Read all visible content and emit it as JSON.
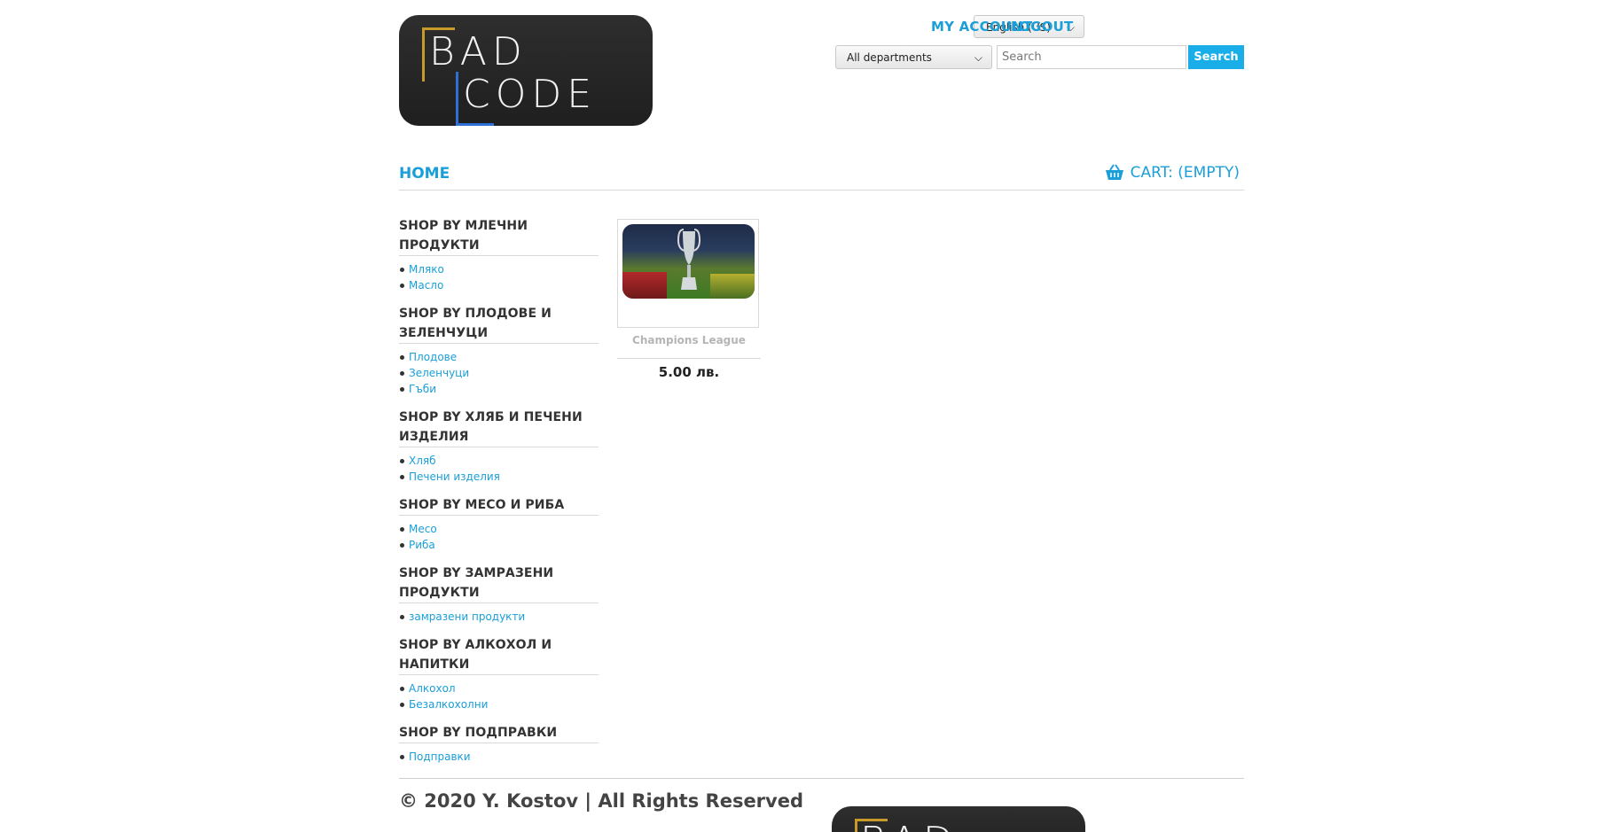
{
  "logo": {
    "line1": "BAD",
    "line2": "CODE"
  },
  "header": {
    "language": "English (US)",
    "my_account": "MY ACCOUNT",
    "logout": "LOGOUT",
    "department": "All departments",
    "search_placeholder": "Search",
    "search_button": "Search"
  },
  "nav": {
    "home": "HOME",
    "cart": "CART: (EMPTY)"
  },
  "sidebar": {
    "categories": [
      {
        "title": "SHOP BY МЛЕЧНИ ПРОДУКТИ",
        "items": [
          "Мляко",
          "Масло"
        ]
      },
      {
        "title": "SHOP BY ПЛОДОВЕ И ЗЕЛЕНЧУЦИ",
        "items": [
          "Плодове",
          "Зеленчуци",
          "Гъби"
        ]
      },
      {
        "title": "SHOP BY ХЛЯБ И ПЕЧЕНИ ИЗДЕЛИЯ",
        "items": [
          "Хляб",
          "Печени изделия"
        ]
      },
      {
        "title": "SHOP BY МЕСО И РИБА",
        "items": [
          "Месо",
          "Риба"
        ]
      },
      {
        "title": "SHOP BY ЗАМРАЗЕНИ ПРОДУКТИ",
        "items": [
          "замразени продукти"
        ]
      },
      {
        "title": "SHOP BY АЛКОХОЛ И НАПИТКИ",
        "items": [
          "Алкохол",
          "Безалкохолни"
        ]
      },
      {
        "title": "SHOP BY ПОДПРАВКИ",
        "items": [
          "Подправки"
        ]
      }
    ]
  },
  "product": {
    "name": "Champions League",
    "price": "5.00 лв."
  },
  "footer": {
    "copyright": "© 2020 Y. Kostov | All Rights Reserved"
  },
  "colors": {
    "accent": "#1a9fd8",
    "search_button_bg": "#19aee8"
  }
}
